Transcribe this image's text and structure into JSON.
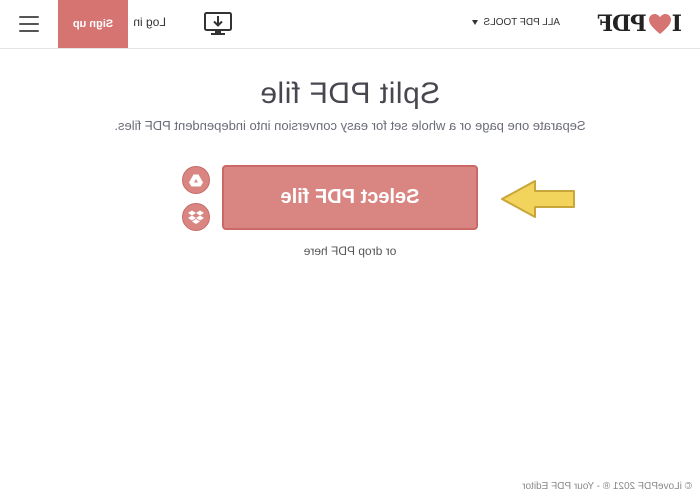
{
  "header": {
    "logo_text_left": "I",
    "logo_text_right": "PDF",
    "all_tools_label": "ALL PDF TOOLS",
    "login_label": "Log in",
    "signup_label": "Sign up"
  },
  "main": {
    "title": "Split PDF file",
    "subtitle": "Separate one page or a whole set for easy conversion into independent PDF files.",
    "select_button_label": "Select PDF file",
    "drop_hint": "or drop PDF here"
  },
  "footer": {
    "copyright": "© iLovePDF 2021 ® - Your PDF Editor"
  },
  "icons": {
    "logo_heart": "heart-icon",
    "desktop": "desktop-download-icon",
    "menu": "hamburger-menu-icon",
    "google_drive": "google-drive-icon",
    "dropbox": "dropbox-icon",
    "arrow": "arrow-icon"
  },
  "colors": {
    "brand_red": "#d57471",
    "button_red": "#d98582",
    "arrow_yellow": "#f2d35c",
    "title_text": "#47474f"
  }
}
